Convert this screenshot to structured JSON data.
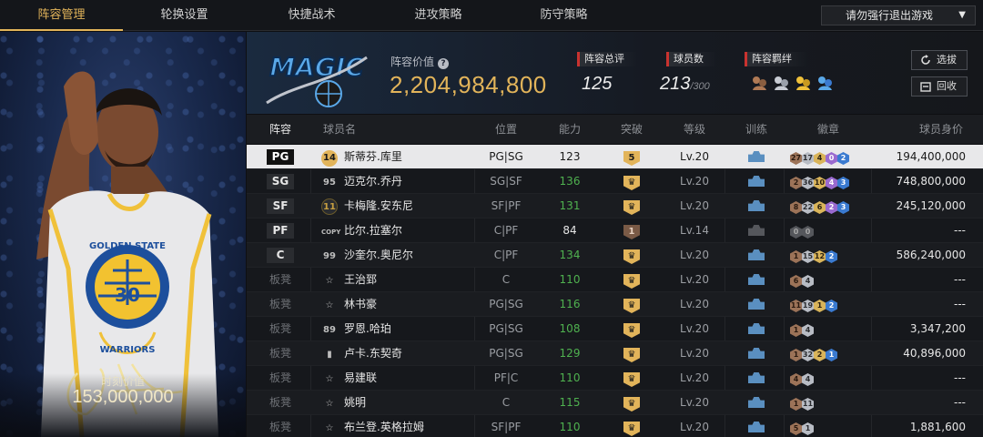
{
  "nav": {
    "tabs": [
      "阵容管理",
      "轮换设置",
      "快捷战术",
      "进攻策略",
      "防守策略"
    ],
    "active_tab": 0,
    "exit_select": "请勿强行退出游戏"
  },
  "card": {
    "jersey_team": "GOLDEN STATE",
    "jersey_name": "WARRIORS",
    "jersey_number": "30",
    "moment_label": "时刻价值",
    "moment_value": "153,000,000"
  },
  "header": {
    "team_logo_text": "MAGIC",
    "lineup_value_label": "阵容价值",
    "lineup_value": "2,204,984,800",
    "overall_label": "阵容总评",
    "overall_value": "125",
    "player_count_label": "球员数",
    "player_count_value": "213",
    "player_count_max": "/300",
    "chemistry_label": "阵容羁绊",
    "draft_button": "选拔",
    "recall_button": "回收"
  },
  "table": {
    "headers": [
      "阵容",
      "球员名",
      "位置",
      "能力",
      "突破",
      "等级",
      "训练",
      "徽章",
      "球员身价"
    ],
    "rows": [
      {
        "slot": "PG",
        "num": "14",
        "num_style": "gold",
        "name": "斯蒂芬.库里",
        "role": "PG|SG",
        "ability": "123",
        "ability_style": "white",
        "break": "5",
        "break_style": "gold",
        "level": "Lv.20",
        "train": "blue",
        "badges": [
          [
            "27",
            "bronze"
          ],
          [
            "17",
            "silver"
          ],
          [
            "4",
            "gold"
          ],
          [
            "0",
            "purple"
          ],
          [
            "2",
            "blue"
          ]
        ],
        "price": "194,400,000",
        "selected": true
      },
      {
        "slot": "SG",
        "num": "95",
        "num_style": "plain",
        "name": "迈克尔.乔丹",
        "role": "SG|SF",
        "ability": "136",
        "ability_style": "green",
        "break": "♛",
        "break_style": "gold",
        "level": "Lv.20",
        "train": "blue",
        "badges": [
          [
            "2",
            "bronze"
          ],
          [
            "36",
            "silver"
          ],
          [
            "10",
            "gold"
          ],
          [
            "4",
            "purple"
          ],
          [
            "3",
            "blue"
          ]
        ],
        "price": "748,800,000"
      },
      {
        "slot": "SF",
        "num": "11",
        "num_style": "dark",
        "name": "卡梅隆.安东尼",
        "role": "SF|PF",
        "ability": "131",
        "ability_style": "green",
        "break": "♛",
        "break_style": "gold",
        "level": "Lv.20",
        "train": "blue",
        "badges": [
          [
            "8",
            "bronze"
          ],
          [
            "22",
            "silver"
          ],
          [
            "6",
            "gold"
          ],
          [
            "2",
            "purple"
          ],
          [
            "3",
            "blue"
          ]
        ],
        "price": "245,120,000"
      },
      {
        "slot": "PF",
        "num": "COPY",
        "num_style": "plain",
        "name": "比尔.拉塞尔",
        "role": "C|PF",
        "ability": "84",
        "ability_style": "white",
        "break": "1",
        "break_style": "brown",
        "level": "Lv.14",
        "train": "grey",
        "badges": [
          [
            "0",
            "dark"
          ],
          [
            "0",
            "dark"
          ]
        ],
        "price": "---"
      },
      {
        "slot": "C",
        "num": "99",
        "num_style": "plain",
        "name": "沙奎尔.奥尼尔",
        "role": "C|PF",
        "ability": "134",
        "ability_style": "green",
        "break": "♛",
        "break_style": "gold",
        "level": "Lv.20",
        "train": "blue",
        "badges": [
          [
            "1",
            "bronze"
          ],
          [
            "15",
            "silver"
          ],
          [
            "12",
            "gold"
          ],
          [
            "2",
            "blue"
          ]
        ],
        "price": "586,240,000"
      },
      {
        "slot": "板凳",
        "num": "☆",
        "num_style": "plain",
        "name": "王治郅",
        "role": "C",
        "ability": "110",
        "ability_style": "green",
        "break": "♛",
        "break_style": "gold",
        "level": "Lv.20",
        "train": "blue",
        "badges": [
          [
            "6",
            "bronze"
          ],
          [
            "4",
            "silver"
          ]
        ],
        "price": "---"
      },
      {
        "slot": "板凳",
        "num": "☆",
        "num_style": "plain",
        "name": "林书豪",
        "role": "PG|SG",
        "ability": "116",
        "ability_style": "green",
        "break": "♛",
        "break_style": "gold",
        "level": "Lv.20",
        "train": "blue",
        "badges": [
          [
            "11",
            "bronze"
          ],
          [
            "19",
            "silver"
          ],
          [
            "1",
            "gold"
          ],
          [
            "2",
            "blue"
          ]
        ],
        "price": "---"
      },
      {
        "slot": "板凳",
        "num": "89",
        "num_style": "plain",
        "name": "罗恩.哈珀",
        "role": "PG|SG",
        "ability": "108",
        "ability_style": "green",
        "break": "♛",
        "break_style": "gold",
        "level": "Lv.20",
        "train": "blue",
        "badges": [
          [
            "1",
            "bronze"
          ],
          [
            "4",
            "silver"
          ]
        ],
        "price": "3,347,200"
      },
      {
        "slot": "板凳",
        "num": "▮",
        "num_style": "plain",
        "name": "卢卡.东契奇",
        "role": "PG|SG",
        "ability": "129",
        "ability_style": "green",
        "break": "♛",
        "break_style": "gold",
        "level": "Lv.20",
        "train": "blue",
        "badges": [
          [
            "1",
            "bronze"
          ],
          [
            "32",
            "silver"
          ],
          [
            "2",
            "gold"
          ],
          [
            "1",
            "blue"
          ]
        ],
        "price": "40,896,000"
      },
      {
        "slot": "板凳",
        "num": "☆",
        "num_style": "plain",
        "name": "易建联",
        "role": "PF|C",
        "ability": "110",
        "ability_style": "green",
        "break": "♛",
        "break_style": "gold",
        "level": "Lv.20",
        "train": "blue",
        "badges": [
          [
            "4",
            "bronze"
          ],
          [
            "4",
            "silver"
          ]
        ],
        "price": "---"
      },
      {
        "slot": "板凳",
        "num": "☆",
        "num_style": "plain",
        "name": "姚明",
        "role": "C",
        "ability": "115",
        "ability_style": "green",
        "break": "♛",
        "break_style": "gold",
        "level": "Lv.20",
        "train": "blue",
        "badges": [
          [
            "1",
            "bronze"
          ],
          [
            "11",
            "silver"
          ]
        ],
        "price": "---"
      },
      {
        "slot": "板凳",
        "num": "☆",
        "num_style": "plain",
        "name": "布兰登.英格拉姆",
        "role": "SF|PF",
        "ability": "110",
        "ability_style": "green",
        "break": "♛",
        "break_style": "gold",
        "level": "Lv.20",
        "train": "blue",
        "badges": [
          [
            "5",
            "bronze"
          ],
          [
            "1",
            "silver"
          ]
        ],
        "price": "1,881,600"
      }
    ]
  },
  "colors": {
    "accent_gold": "#e2b45a",
    "ability_green": "#4fb14f",
    "tag_red": "#c9322f"
  }
}
